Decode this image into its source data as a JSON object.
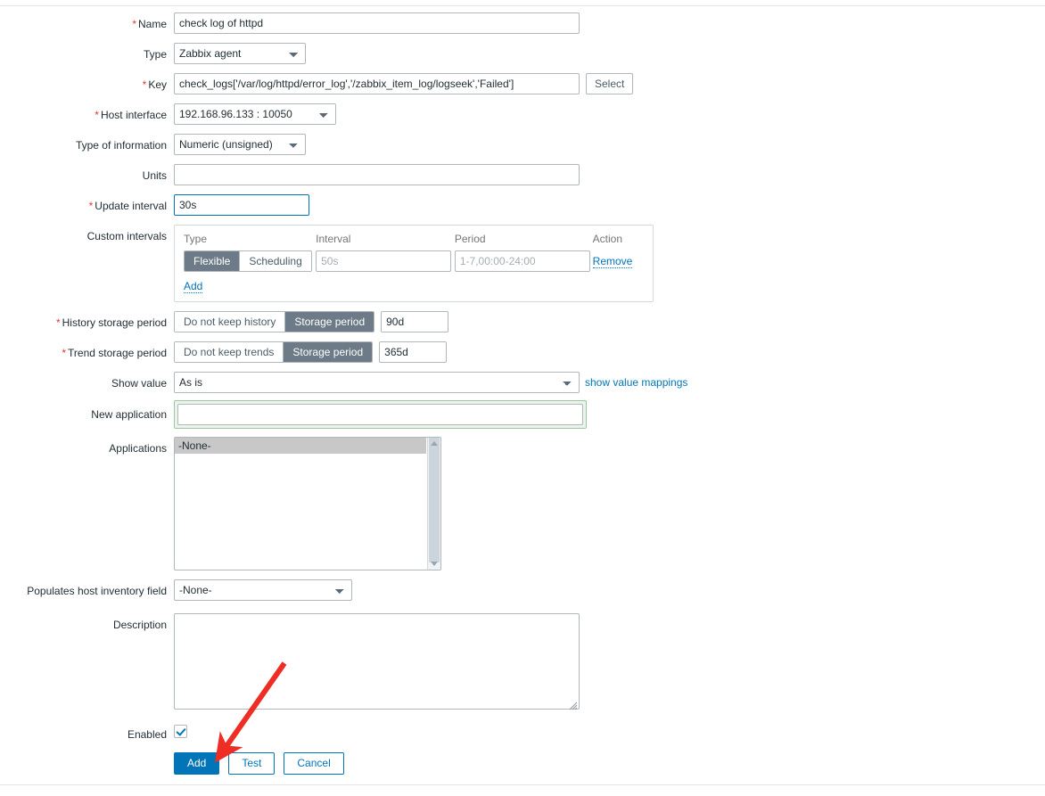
{
  "form": {
    "fields": {
      "name": {
        "label": "Name",
        "required": true,
        "value": "check log of httpd"
      },
      "type": {
        "label": "Type",
        "required": false,
        "value": "Zabbix agent"
      },
      "key": {
        "label": "Key",
        "required": true,
        "value": "check_logs['/var/log/httpd/error_log','/zabbix_item_log/logseek','Failed']",
        "select_button": "Select"
      },
      "host_interface": {
        "label": "Host interface",
        "required": true,
        "value": "192.168.96.133 : 10050"
      },
      "type_of_information": {
        "label": "Type of information",
        "required": false,
        "value": "Numeric (unsigned)"
      },
      "units": {
        "label": "Units",
        "required": false,
        "value": ""
      },
      "update_interval": {
        "label": "Update interval",
        "required": true,
        "value": "30s",
        "focused": true
      },
      "custom_intervals": {
        "label": "Custom intervals",
        "columns": [
          "Type",
          "Interval",
          "Period",
          "Action"
        ],
        "rows": [
          {
            "type_options": [
              "Flexible",
              "Scheduling"
            ],
            "type_selected": "Flexible",
            "interval_value": "",
            "interval_placeholder": "50s",
            "period_value": "",
            "period_placeholder": "1-7,00:00-24:00",
            "action_label": "Remove"
          }
        ],
        "add_label": "Add"
      },
      "history_storage_period": {
        "label": "History storage period",
        "required": true,
        "options": [
          "Do not keep history",
          "Storage period"
        ],
        "selected": "Storage period",
        "value": "90d"
      },
      "trend_storage_period": {
        "label": "Trend storage period",
        "required": true,
        "options": [
          "Do not keep trends",
          "Storage period"
        ],
        "selected": "Storage period",
        "value": "365d"
      },
      "show_value": {
        "label": "Show value",
        "value": "As is",
        "link_label": "show value mappings"
      },
      "new_application": {
        "label": "New application",
        "value": "",
        "highlighted": true
      },
      "applications": {
        "label": "Applications",
        "options": [
          "-None-"
        ],
        "selected": "-None-"
      },
      "populates_host_inventory_field": {
        "label": "Populates host inventory field",
        "value": "-None-"
      },
      "description": {
        "label": "Description",
        "value": ""
      },
      "enabled": {
        "label": "Enabled",
        "checked": true
      }
    },
    "buttons": {
      "add": "Add",
      "test": "Test",
      "cancel": "Cancel"
    }
  },
  "annotation": {
    "arrow_color": "#ee2d24",
    "points_to": "add-button"
  }
}
